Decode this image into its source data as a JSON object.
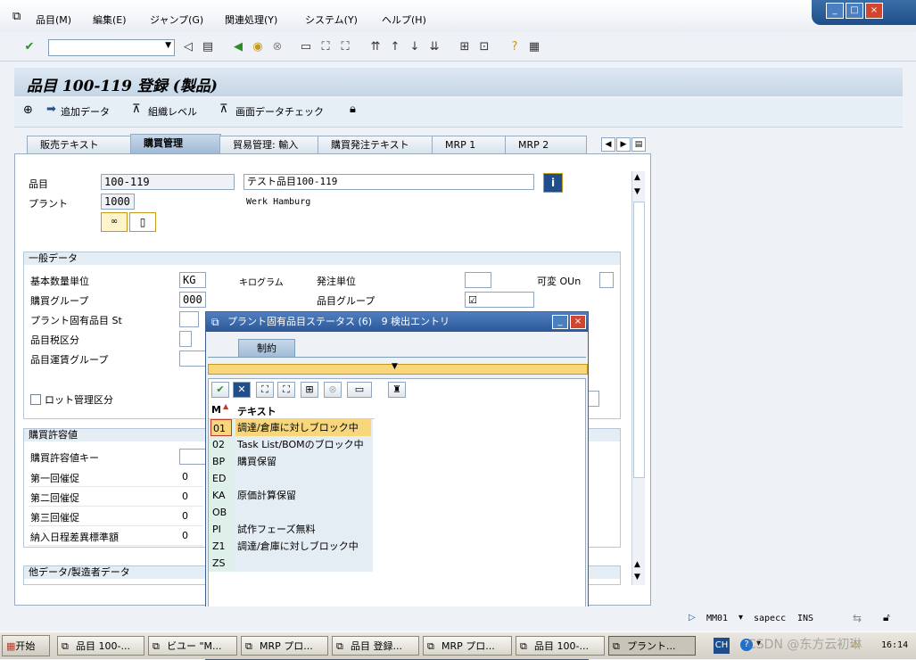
{
  "menu": {
    "items": [
      "品目(M)",
      "編集(E)",
      "ジャンプ(G)",
      "関連処理(Y)",
      "システム(Y)",
      "ヘルプ(H)"
    ]
  },
  "window": {
    "buttons": [
      "_",
      "□",
      "×"
    ]
  },
  "page": {
    "title": "品目 100-119 登録 (製品)"
  },
  "app_toolbar": {
    "add_data": "追加データ",
    "org_level": "組織レベル",
    "check_screen": "画面データチェック"
  },
  "tabs": [
    {
      "label": "販売テキスト"
    },
    {
      "label": "購買管理"
    },
    {
      "label": "貿易管理: 輸入"
    },
    {
      "label": "購買発注テキスト"
    },
    {
      "label": "MRP 1"
    },
    {
      "label": "MRP 2"
    }
  ],
  "header": {
    "material_label": "品目",
    "material_value": "100-119",
    "material_desc": "テスト品目100-119",
    "plant_label": "プラント",
    "plant_value": "1000",
    "plant_name": "Werk Hamburg"
  },
  "general": {
    "title": "一般データ",
    "base_uom_label": "基本数量単位",
    "base_uom_value": "KG",
    "base_uom_text": "キログラム",
    "order_unit_label": "発注単位",
    "variable_label": "可変 OUn",
    "purch_group_label": "購買グループ",
    "purch_group_value": "000",
    "mat_group_label": "品目グループ",
    "plant_status_label": "プラント固有品目 St",
    "tax_label": "品目税区分",
    "freight_label": "品目運賃グループ",
    "batch_label": "ロット管理区分"
  },
  "tolerance": {
    "title": "購買許容値",
    "key_label": "購買許容値キー",
    "rows": [
      {
        "label": "第一回催促",
        "value": "0"
      },
      {
        "label": "第二回催促",
        "value": "0"
      },
      {
        "label": "第三回催促",
        "value": "0"
      },
      {
        "label": "納入日程差異標準額",
        "value": "0"
      }
    ]
  },
  "other": {
    "title": "他データ/製造者データ"
  },
  "popup": {
    "title": "プラント固有品目ステータス (6)   9 検出エントリ",
    "tab": "制約",
    "col_code": "M",
    "col_text": "テキスト",
    "rows": [
      {
        "code": "01",
        "text": "調達/倉庫に対しブロック中"
      },
      {
        "code": "02",
        "text": "Task List/BOMのブロック中"
      },
      {
        "code": "BP",
        "text": "購買保留"
      },
      {
        "code": "ED",
        "text": ""
      },
      {
        "code": "KA",
        "text": "原価計算保留"
      },
      {
        "code": "OB",
        "text": ""
      },
      {
        "code": "PI",
        "text": "試作フェーズ無料"
      },
      {
        "code": "Z1",
        "text": "調達/倉庫に対しブロック中"
      },
      {
        "code": "ZS",
        "text": ""
      }
    ]
  },
  "status": {
    "tcode": "MM01",
    "server": "sapecc",
    "mode": "INS"
  },
  "taskbar": {
    "start": "开始",
    "tasks": [
      "品目 100-...",
      "ビユー \"M...",
      "MRP プロ...",
      "品目 登録...",
      "MRP プロ...",
      "品目 100-...",
      "プラント..."
    ],
    "lang": "CH",
    "clock": "16:14",
    "watermark": "CSDN @东方云初琳"
  },
  "colors": {
    "accent": "#2c5798",
    "selected_row": "#f8d77c",
    "code_column": "#dff0ea"
  }
}
